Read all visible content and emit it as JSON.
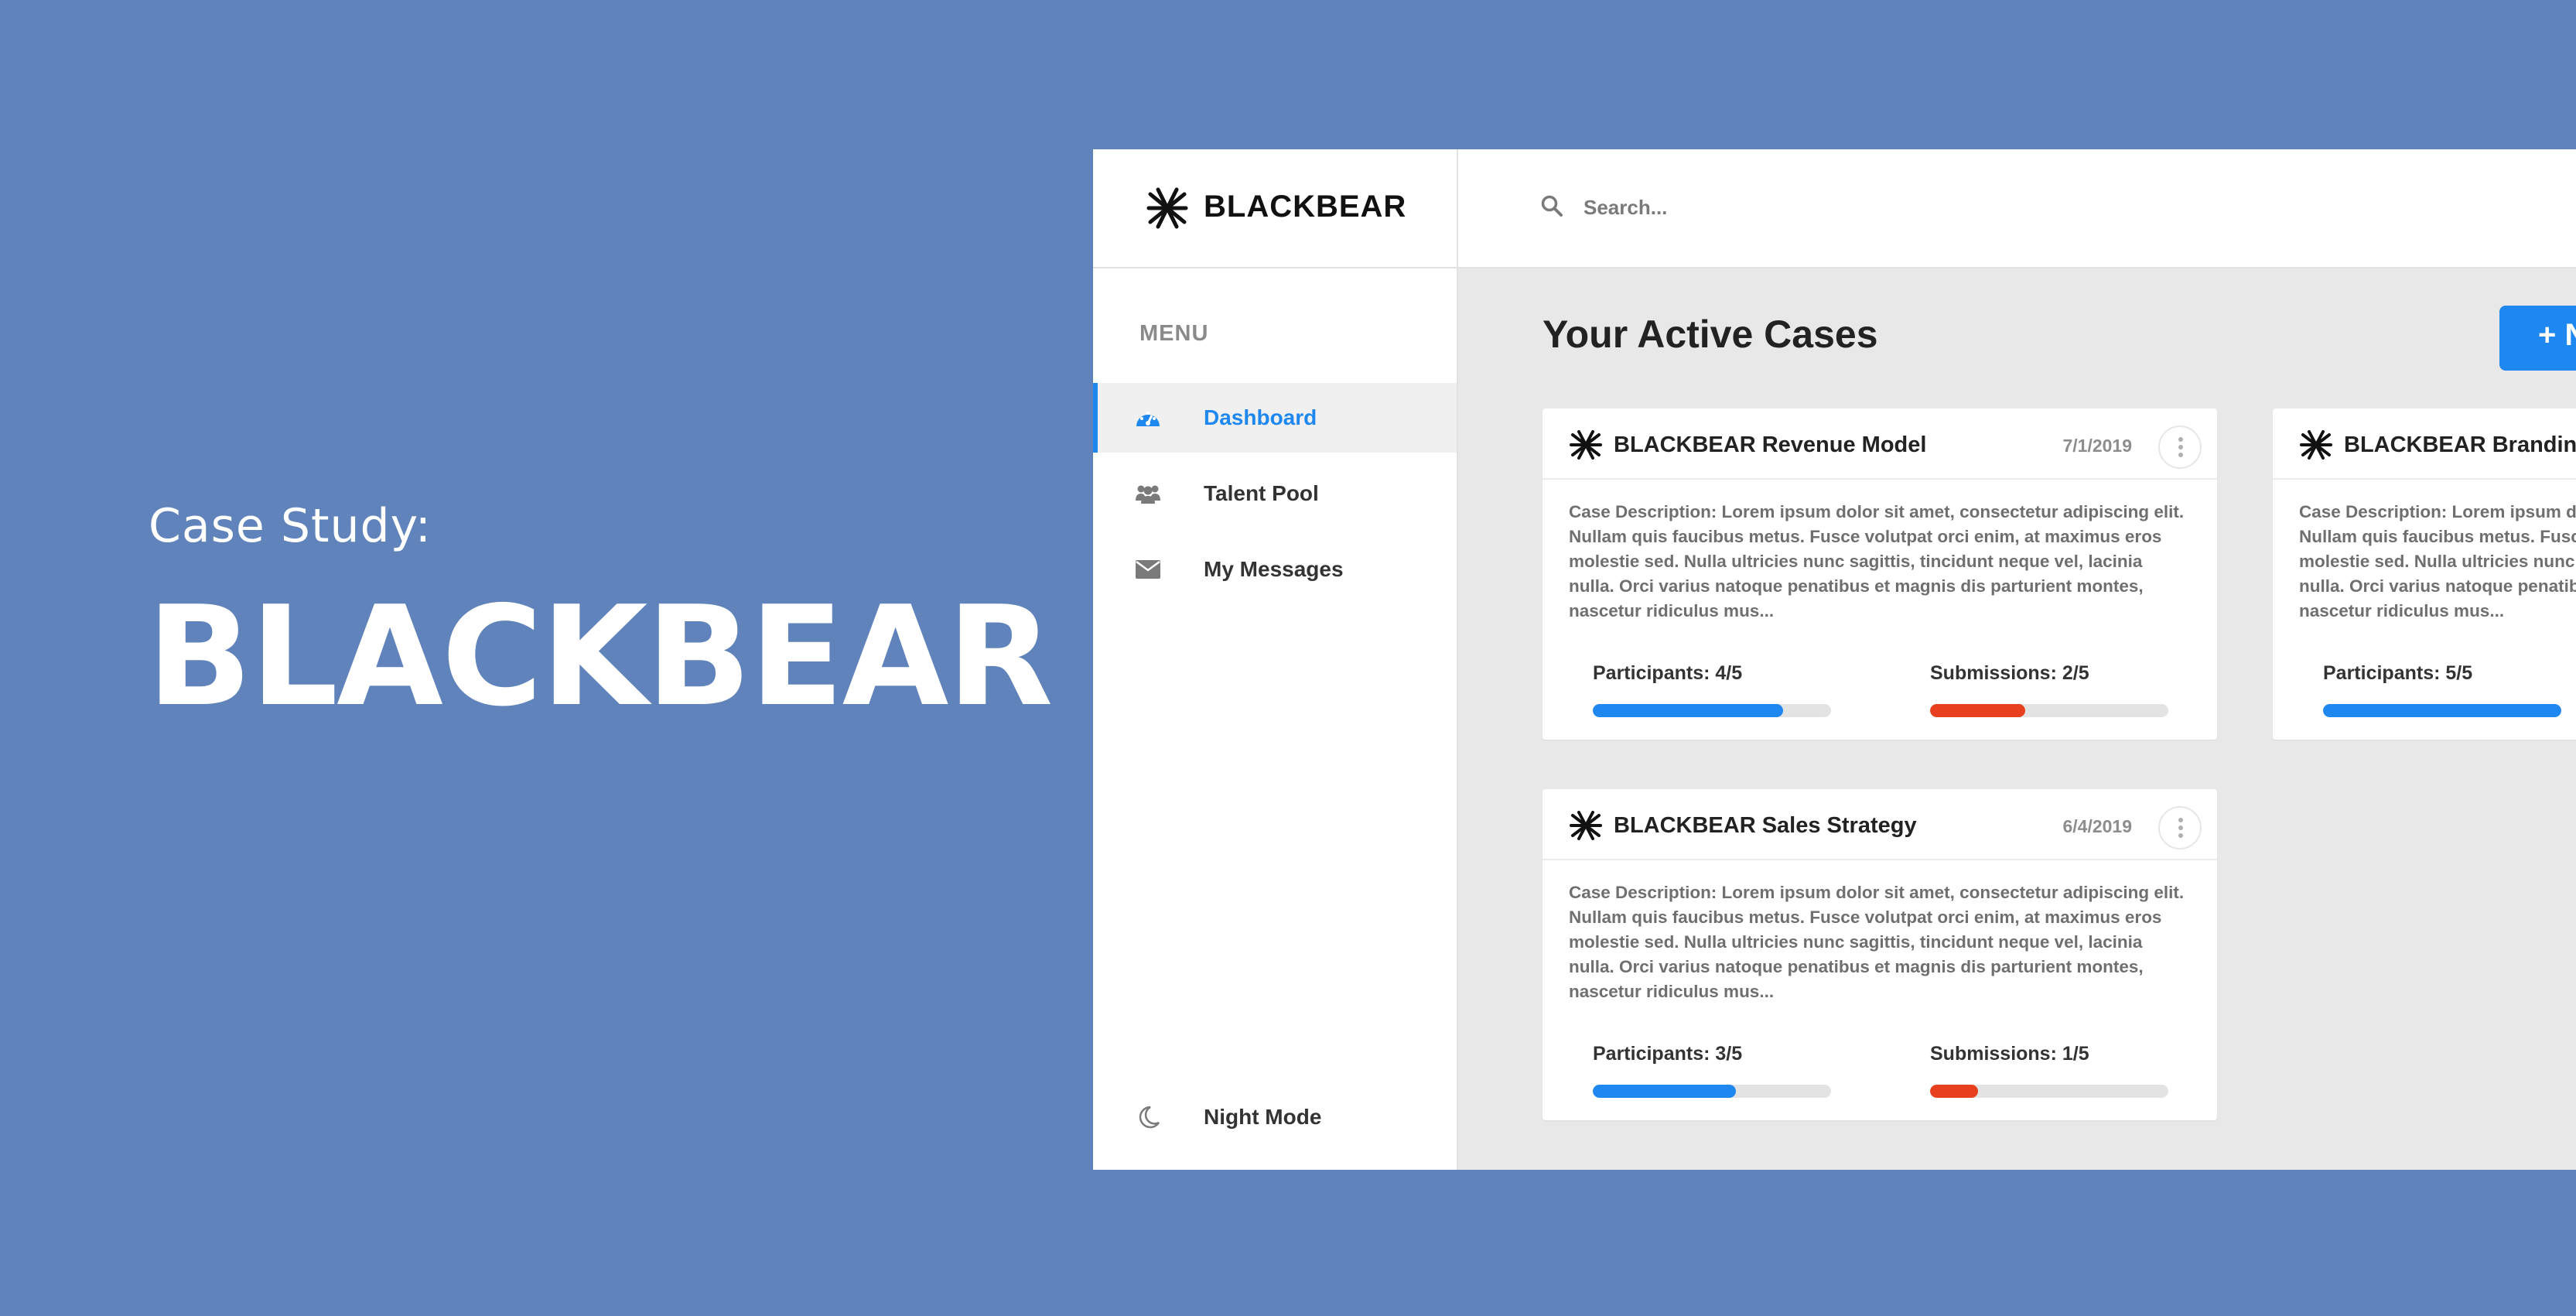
{
  "hero": {
    "subtitle": "Case Study:",
    "title": "BLACKBEAR"
  },
  "brand": {
    "name": "BLACKBEAR",
    "logo_icon": "blackbear-claw-logo"
  },
  "sidebar": {
    "menu_label": "MENU",
    "items": [
      {
        "label": "Dashboard",
        "icon": "dashboard-icon",
        "active": true
      },
      {
        "label": "Talent Pool",
        "icon": "users-icon",
        "active": false
      },
      {
        "label": "My Messages",
        "icon": "envelope-icon",
        "active": false
      }
    ],
    "night_mode": {
      "label": "Night Mode",
      "icon": "moon-icon"
    }
  },
  "search": {
    "placeholder": "Search..."
  },
  "main": {
    "title": "Your Active Cases",
    "new_button_label": "+ N",
    "cases": [
      {
        "title": "BLACKBEAR Revenue Model",
        "date": "7/1/2019",
        "description": "Case Description: Lorem ipsum dolor sit amet, consectetur adipiscing elit. Nullam quis faucibus metus. Fusce volutpat orci enim, at maximus eros molestie sed. Nulla ultricies nunc sagittis, tincidunt neque vel, lacinia nulla. Orci varius natoque penatibus et magnis dis parturient montes, nascetur ridiculus mus...",
        "participants_label": "Participants: 4/5",
        "participants_fraction": 0.8,
        "submissions_label": "Submissions: 2/5",
        "submissions_fraction": 0.4
      },
      {
        "title": "BLACKBEAR Branding",
        "date": "",
        "description": "Case Description: Lorem ipsum dolor sit amet, consectetur adipiscing elit. Nullam quis faucibus metus. Fusce volutpat orci enim, at maximus eros molestie sed. Nulla ultricies nunc sagittis, tincidunt neque vel, lacinia nulla. Orci varius natoque penatibus et magnis dis parturient montes, nascetur ridiculus mus...",
        "participants_label": "Participants: 5/5",
        "participants_fraction": 1.0,
        "submissions_label": "",
        "submissions_fraction": 0
      },
      {
        "title": "BLACKBEAR Sales Strategy",
        "date": "6/4/2019",
        "description": "Case Description: Lorem ipsum dolor sit amet, consectetur adipiscing elit. Nullam quis faucibus metus. Fusce volutpat orci enim, at maximus eros molestie sed. Nulla ultricies nunc sagittis, tincidunt neque vel, lacinia nulla. Orci varius natoque penatibus et magnis dis parturient montes, nascetur ridiculus mus...",
        "participants_label": "Participants: 3/5",
        "participants_fraction": 0.6,
        "submissions_label": "Submissions: 1/5",
        "submissions_fraction": 0.2
      }
    ]
  },
  "colors": {
    "background": "#5f83ba",
    "accent": "#1e87f0",
    "danger": "#e8401f"
  }
}
